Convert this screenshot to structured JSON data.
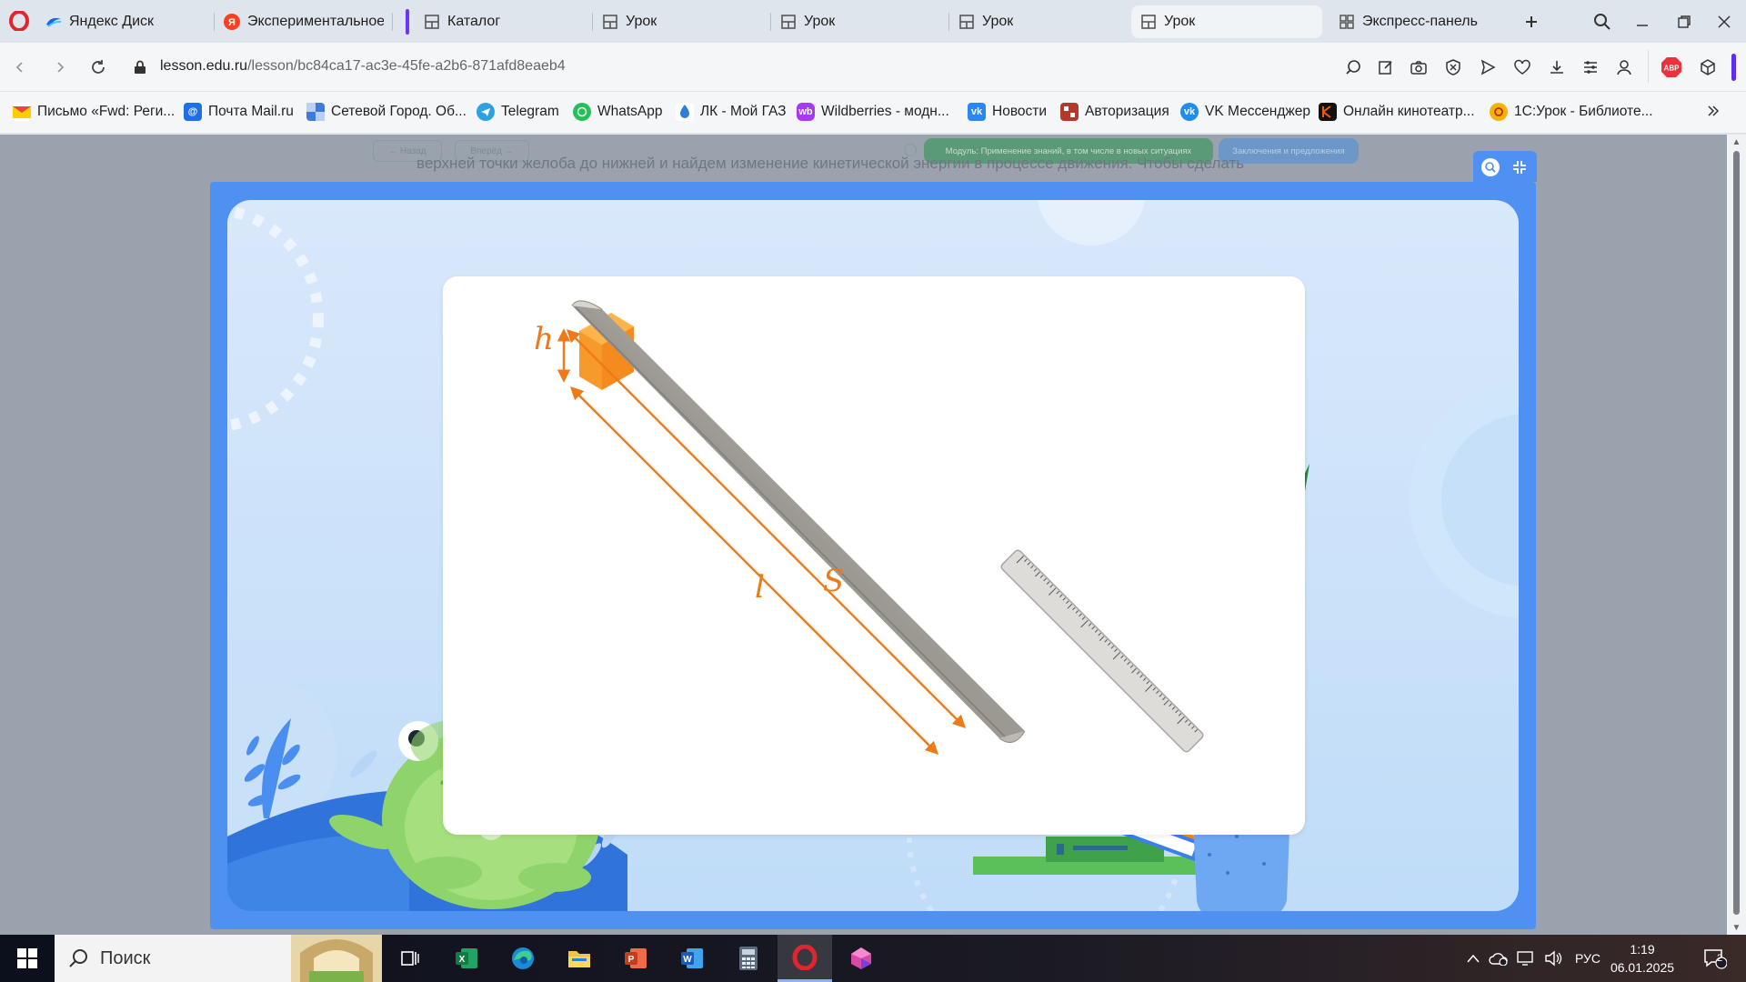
{
  "browser": {
    "tabs": [
      {
        "label": "Яндекс Диск",
        "icon": "yandex-disk-icon",
        "active": false
      },
      {
        "label": "Экспериментальное оп",
        "icon": "yandex-icon",
        "active": false
      },
      {
        "label": "Каталог",
        "icon": "page-icon",
        "active": false
      },
      {
        "label": "Урок",
        "icon": "page-icon",
        "active": false
      },
      {
        "label": "Урок",
        "icon": "page-icon",
        "active": false
      },
      {
        "label": "Урок",
        "icon": "page-icon",
        "active": false
      },
      {
        "label": "Урок",
        "icon": "page-icon",
        "active": true
      },
      {
        "label": "Экспресс-панель",
        "icon": "speed-dial-icon",
        "active": false
      }
    ],
    "url": {
      "domain": "lesson.edu.ru",
      "path": "/lesson/bc84ca17-ac3e-45fe-a2b6-871afd8eaeb4"
    },
    "bookmarks": [
      {
        "label": "Письмо «Fwd: Реги...",
        "color": "#e8483a"
      },
      {
        "label": "Почта Mail.ru",
        "color": "#1e6fe8"
      },
      {
        "label": "Сетевой Город. Об...",
        "color": "#3f7ad8"
      },
      {
        "label": "Telegram",
        "color": "#2aa3e0"
      },
      {
        "label": "WhatsApp",
        "color": "#25c05a"
      },
      {
        "label": "ЛК - Мой ГАЗ",
        "color": "#2b7fd6"
      },
      {
        "label": "Wildberries - модн...",
        "color": "#a73af1"
      },
      {
        "label": "Новости",
        "color": "#2787f5"
      },
      {
        "label": "Авторизация",
        "color": "#b23a2a"
      },
      {
        "label": "VK Мессенджер",
        "color": "#1f8cf0"
      },
      {
        "label": "Онлайн кинотеатр...",
        "color": "#f05a10"
      },
      {
        "label": "1С:Урок - Библиоте...",
        "color": "#f2b400"
      }
    ]
  },
  "lesson": {
    "back_label": "← Назад",
    "forward_label": "Вперёд →",
    "module_pill": "Модуль: Применение знаний, в том числе в новых ситуациях",
    "conclusions_pill": "Заключения и предложения",
    "background_text": "верхней точки желоба до нижней и найдем изменение кинетической энергии в процессе движения. Чтобы сделать",
    "labels": {
      "h": "h",
      "l": "l",
      "s": "S"
    },
    "colors": {
      "frame": "#4f91f2",
      "arrow": "#ef7a1a",
      "block": "#f79a2c"
    }
  },
  "taskbar": {
    "search_label": "Поиск",
    "language": "РУС",
    "time": "1:19",
    "date": "06.01.2025",
    "notifications": "2",
    "apps": [
      "task-view",
      "excel",
      "edge",
      "explorer",
      "powerpoint",
      "word",
      "calculator",
      "opera",
      "gem-app"
    ]
  }
}
